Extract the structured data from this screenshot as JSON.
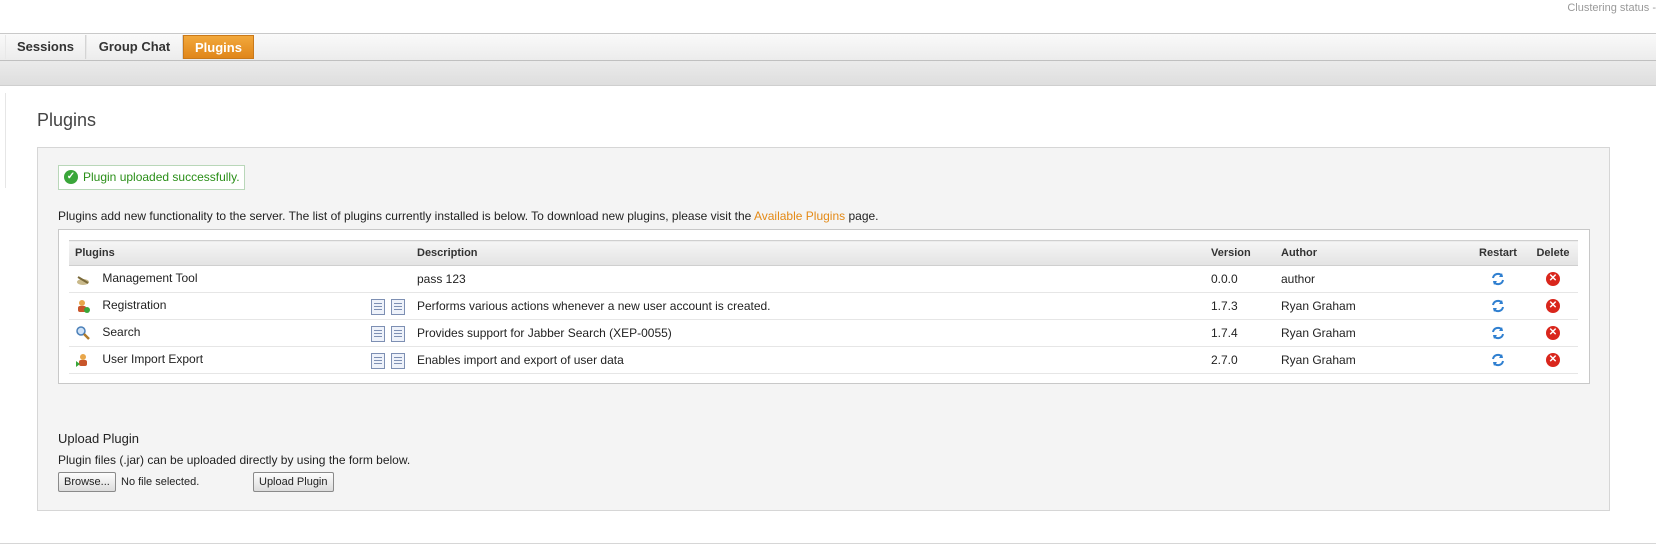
{
  "header": {
    "cluster_status": "Clustering status -"
  },
  "tabs": [
    {
      "label": "Sessions",
      "active": false
    },
    {
      "label": "Group Chat",
      "active": false
    },
    {
      "label": "Plugins",
      "active": true
    }
  ],
  "page": {
    "title": "Plugins",
    "success_message": "Plugin uploaded successfully.",
    "intro_prefix": "Plugins add new functionality to the server. The list of plugins currently installed is below. To download new plugins, please visit the ",
    "intro_link": "Available Plugins",
    "intro_suffix": " page."
  },
  "table": {
    "headers": {
      "plugins": "Plugins",
      "description": "Description",
      "version": "Version",
      "author": "Author",
      "restart": "Restart",
      "delete": "Delete"
    },
    "rows": [
      {
        "name": "Management Tool",
        "icon": "tool-icon",
        "description": "pass 123",
        "version": "0.0.0",
        "author": "author",
        "docs": false
      },
      {
        "name": "Registration",
        "icon": "user-add-icon",
        "description": "Performs various actions whenever a new user account is created.",
        "version": "1.7.3",
        "author": "Ryan Graham",
        "docs": true
      },
      {
        "name": "Search",
        "icon": "magnifier-icon",
        "description": "Provides support for Jabber Search (XEP-0055)",
        "version": "1.7.4",
        "author": "Ryan Graham",
        "docs": true
      },
      {
        "name": "User Import Export",
        "icon": "user-import-icon",
        "description": "Enables import and export of user data",
        "version": "2.7.0",
        "author": "Ryan Graham",
        "docs": true
      }
    ]
  },
  "upload": {
    "title": "Upload Plugin",
    "description": "Plugin files (.jar) can be uploaded directly by using the form below.",
    "browse_label": "Browse...",
    "file_status": "No file selected.",
    "upload_label": "Upload Plugin"
  },
  "colors": {
    "accent": "#e48a16",
    "success": "#2a8f18",
    "delete": "#d9261c",
    "restart": "#2f7fd0"
  }
}
